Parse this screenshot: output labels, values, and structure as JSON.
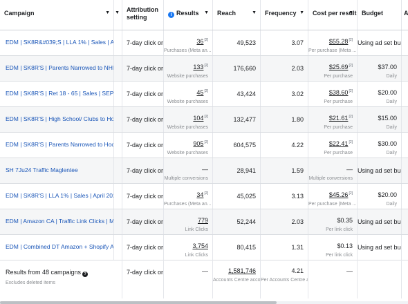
{
  "header": {
    "campaign": "Campaign",
    "attribution": "Attribution setting",
    "results": "Results",
    "reach": "Reach",
    "frequency": "Frequency",
    "cost_per_result": "Cost per result",
    "budget": "Budget",
    "amount_spent": "A"
  },
  "rows": [
    {
      "campaign": "EDM | SK8R&#039;S | LLA 1% | Sales | April 202...",
      "attribution": "7-day click or ...",
      "results": "36",
      "results_sub": "Purchases (Meta an...",
      "reach": "49,523",
      "frequency": "3.07",
      "cpr": "$55.28",
      "cpr_sub": "Per purchase (Meta ...",
      "budget": "Using ad set bud...",
      "budget_sub": ""
    },
    {
      "campaign": "EDM | SK8R'S | Parents Narrowed to NHL Hock...",
      "attribution": "7-day click or ...",
      "results": "133",
      "results_sub": "Website purchases",
      "reach": "176,660",
      "frequency": "2.03",
      "cpr": "$25.69",
      "cpr_sub": "Per purchase",
      "budget": "$37.00",
      "budget_sub": "Daily"
    },
    {
      "campaign": "EDM | SK8R'S | Ret 18 - 65 | Sales | SEP",
      "attribution": "7-day click or ...",
      "results": "45",
      "results_sub": "Website purchases",
      "reach": "43,424",
      "frequency": "3.02",
      "cpr": "$38.60",
      "cpr_sub": "Per purchase",
      "budget": "$20.00",
      "budget_sub": "Daily"
    },
    {
      "campaign": "EDM | SK8R'S | High School/ Clubs to Hockey ...",
      "attribution": "7-day click or ...",
      "results": "104",
      "results_sub": "Website purchases",
      "reach": "132,477",
      "frequency": "1.80",
      "cpr": "$21.61",
      "cpr_sub": "Per purchase",
      "budget": "$15.00",
      "budget_sub": "Daily"
    },
    {
      "campaign": "EDM | SK8R'S | Parents Narrowed to Hockey Au...",
      "attribution": "7-day click or ...",
      "results": "905",
      "results_sub": "Website purchases",
      "reach": "604,575",
      "frequency": "4.22",
      "cpr": "$22.41",
      "cpr_sub": "Per purchase",
      "budget": "$30.00",
      "budget_sub": "Daily"
    },
    {
      "campaign": "SH 7Ju24 Traffic Maglentee",
      "attribution": "7-day click or ...",
      "results": "—",
      "results_sub": "Multiple conversions",
      "reach": "28,941",
      "frequency": "1.59",
      "cpr": "—",
      "cpr_sub": "Multiple conversions",
      "budget": "Using ad set bud...",
      "budget_sub": ""
    },
    {
      "campaign": "EDM | SK8R'S | LLA 1% | Sales | April 2024 dh-$...",
      "attribution": "7-day click or ...",
      "results": "34",
      "results_sub": "Purchases (Meta an...",
      "reach": "45,025",
      "frequency": "3.13",
      "cpr": "$45.26",
      "cpr_sub": "Per purchase (Meta ...",
      "budget": "$20.00",
      "budget_sub": "Daily"
    },
    {
      "campaign": "EDM | Amazon CA | Traffic Link Clicks | March 1...",
      "attribution": "7-day click or ...",
      "results": "779",
      "results_sub": "Link Clicks",
      "reach": "52,244",
      "frequency": "2.03",
      "cpr": "$0.35",
      "cpr_sub": "Per link click",
      "budget": "Using ad set bud...",
      "budget_sub": ""
    },
    {
      "campaign": "EDM | Combined DT Amazon + Shopify ABO U...",
      "attribution": "7-day click or ...",
      "results": "3,754",
      "results_sub": "Link Clicks",
      "reach": "80,415",
      "frequency": "1.31",
      "cpr": "$0.13",
      "cpr_sub": "Per link click",
      "budget": "Using ad set bud...",
      "budget_sub": ""
    }
  ],
  "footer": {
    "label": "Results from 48 campaigns",
    "sub": "Excludes deleted items",
    "attribution": "7-day click or ...",
    "results": "—",
    "reach": "1,581,746",
    "reach_sub": "Accounts Centre acco...",
    "frequency": "4.21",
    "frequency_sub": "Per Accounts Centre a...",
    "cpr": "—"
  }
}
